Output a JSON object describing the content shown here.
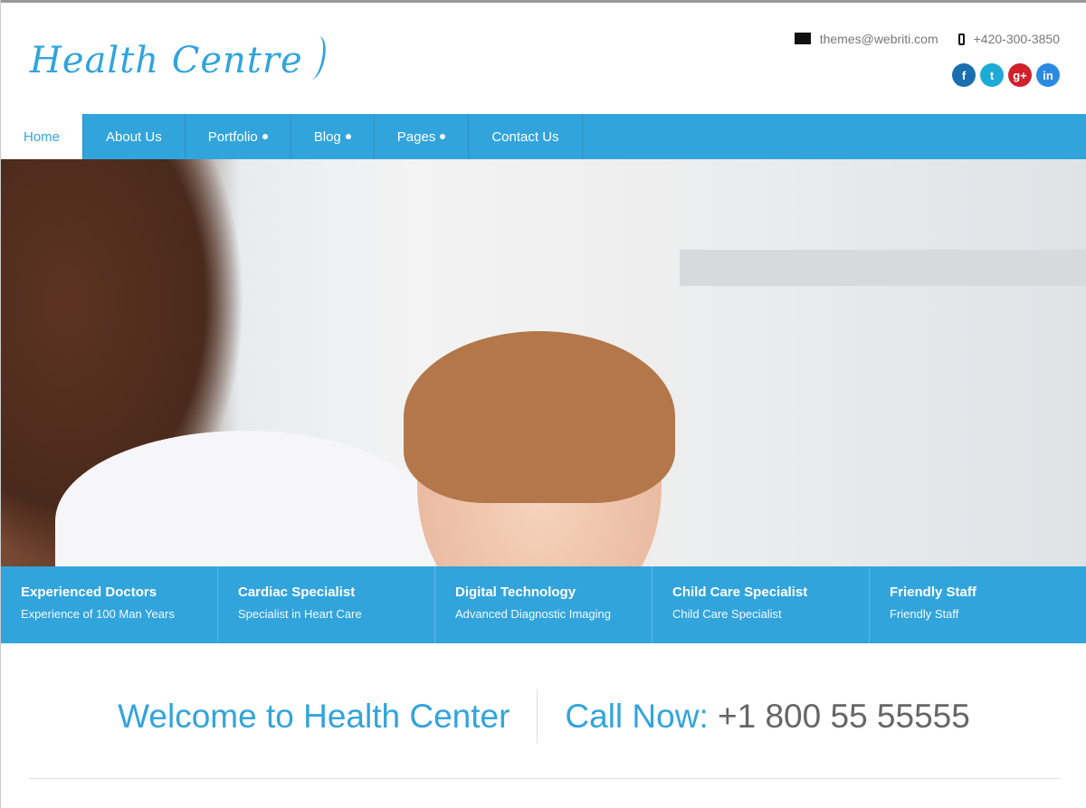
{
  "logo": {
    "text": "Health Centre"
  },
  "contact": {
    "email": "themes@webriti.com",
    "phone": "+420-300-3850"
  },
  "social": [
    {
      "name": "facebook",
      "glyph": "f",
      "color": "#1a6fb0"
    },
    {
      "name": "twitter",
      "glyph": "t",
      "color": "#1eaad6"
    },
    {
      "name": "google-plus",
      "glyph": "g+",
      "color": "#d0202a"
    },
    {
      "name": "linkedin",
      "glyph": "in",
      "color": "#2a8ae0"
    }
  ],
  "nav": [
    {
      "label": "Home",
      "active": true
    },
    {
      "label": "About Us"
    },
    {
      "label": "Portfolio",
      "dropdown": true
    },
    {
      "label": "Blog",
      "dropdown": true
    },
    {
      "label": "Pages",
      "dropdown": true
    },
    {
      "label": "Contact Us"
    }
  ],
  "features": [
    {
      "title": "Experienced Doctors",
      "desc": "Experience of 100 Man Years"
    },
    {
      "title": "Cardiac Specialist",
      "desc": "Specialist in Heart Care"
    },
    {
      "title": "Digital Technology",
      "desc": "Advanced Diagnostic Imaging"
    },
    {
      "title": "Child Care Specialist",
      "desc": "Child Care Specialist"
    },
    {
      "title": "Friendly Staff",
      "desc": "Friendly Staff"
    }
  ],
  "welcome": {
    "title": "Welcome to Health Center",
    "call_label": "Call Now:",
    "call_number": "+1 800 55 55555"
  },
  "colors": {
    "accent": "#32a4dc"
  }
}
